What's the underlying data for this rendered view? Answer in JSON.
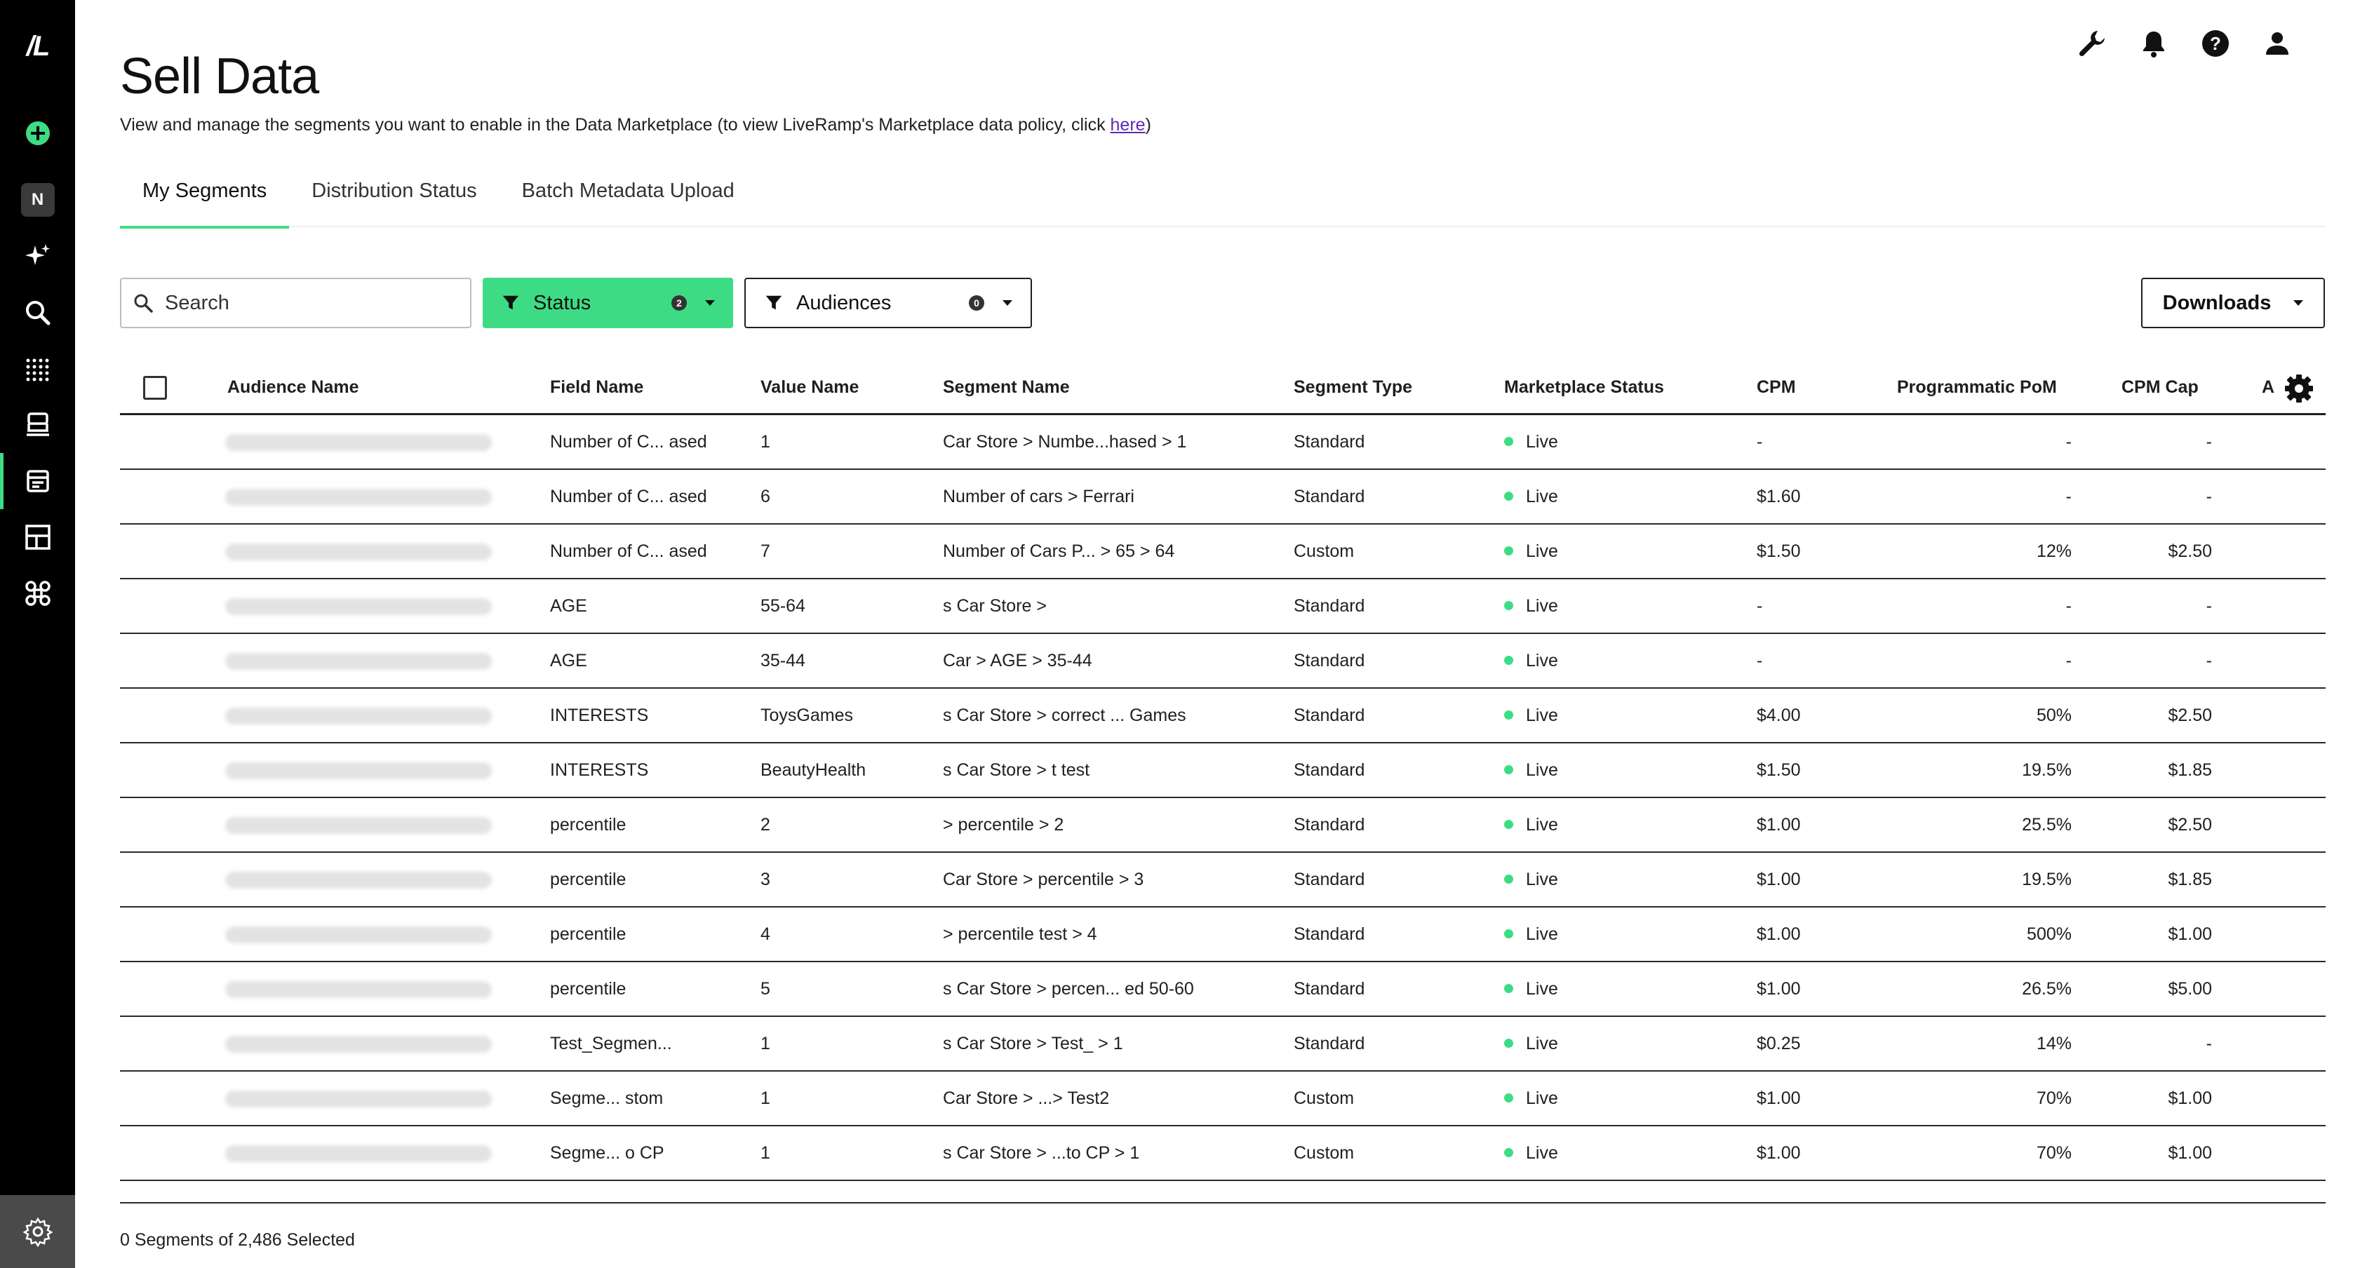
{
  "app": {
    "logo_text": "/L",
    "workspace_initial": "N"
  },
  "header": {
    "title": "Sell Data",
    "description_prefix": "View and manage the segments you want to enable in the Data Marketplace (to view LiveRamp's Marketplace data policy, click ",
    "description_link": "here",
    "description_suffix": ")"
  },
  "tabs": [
    {
      "label": "My Segments",
      "active": true
    },
    {
      "label": "Distribution Status",
      "active": false
    },
    {
      "label": "Batch Metadata Upload",
      "active": false
    }
  ],
  "controls": {
    "search_placeholder": "Search",
    "status_filter": {
      "label": "Status",
      "count": "2"
    },
    "audiences_filter": {
      "label": "Audiences",
      "count": "0"
    },
    "downloads_label": "Downloads"
  },
  "table": {
    "headers": {
      "audience_name": "Audience Name",
      "field_name": "Field Name",
      "value_name": "Value Name",
      "segment_name": "Segment Name",
      "segment_type": "Segment Type",
      "marketplace_status": "Marketplace Status",
      "cpm": "CPM",
      "programmatic_pom": "Programmatic PoM",
      "cpm_cap": "CPM Cap",
      "extra": "A"
    },
    "rows": [
      {
        "field": "Number of C...  ased",
        "value": "1",
        "segment": "Car Store > Numbe...hased > 1",
        "type": "Standard",
        "status": "Live",
        "cpm": "-",
        "pom": "-",
        "cap": "-"
      },
      {
        "field": "Number of C...  ased",
        "value": "6",
        "segment": "Number of cars > Ferrari",
        "type": "Standard",
        "status": "Live",
        "cpm": "$1.60",
        "pom": "-",
        "cap": "-"
      },
      {
        "field": "Number of C...  ased",
        "value": "7",
        "segment": "Number of Cars P...  > 65 > 64",
        "type": "Custom",
        "status": "Live",
        "cpm": "$1.50",
        "pom": "12%",
        "cap": "$2.50"
      },
      {
        "field": "AGE",
        "value": "55-64",
        "segment": "s Car Store > ",
        "type": "Standard",
        "status": "Live",
        "cpm": "-",
        "pom": "-",
        "cap": "-"
      },
      {
        "field": "AGE",
        "value": "35-44",
        "segment": "Car > AGE > 35-44",
        "type": "Standard",
        "status": "Live",
        "cpm": "-",
        "pom": "-",
        "cap": "-"
      },
      {
        "field": "INTERESTS",
        "value": "ToysGames",
        "segment": "s Car Store > correct ...  Games",
        "type": "Standard",
        "status": "Live",
        "cpm": "$4.00",
        "pom": "50%",
        "cap": "$2.50"
      },
      {
        "field": "INTERESTS",
        "value": "BeautyHealth",
        "segment": "s Car Store >  t test",
        "type": "Standard",
        "status": "Live",
        "cpm": "$1.50",
        "pom": "19.5%",
        "cap": "$1.85"
      },
      {
        "field": "percentile",
        "value": "2",
        "segment": "> percentile > 2",
        "type": "Standard",
        "status": "Live",
        "cpm": "$1.00",
        "pom": "25.5%",
        "cap": "$2.50"
      },
      {
        "field": "percentile",
        "value": "3",
        "segment": "Car Store > percentile > 3",
        "type": "Standard",
        "status": "Live",
        "cpm": "$1.00",
        "pom": "19.5%",
        "cap": "$1.85"
      },
      {
        "field": "percentile",
        "value": "4",
        "segment": "> percentile test > 4",
        "type": "Standard",
        "status": "Live",
        "cpm": "$1.00",
        "pom": "500%",
        "cap": "$1.00"
      },
      {
        "field": "percentile",
        "value": "5",
        "segment": "s Car Store > percen...  ed 50-60",
        "type": "Standard",
        "status": "Live",
        "cpm": "$1.00",
        "pom": "26.5%",
        "cap": "$5.00"
      },
      {
        "field": "Test_Segmen...",
        "value": "1",
        "segment": "s Car Store > Test_ > 1",
        "type": "Standard",
        "status": "Live",
        "cpm": "$0.25",
        "pom": "14%",
        "cap": "-"
      },
      {
        "field": "Segme...  stom",
        "value": "1",
        "segment": "Car Store >  ...> Test2",
        "type": "Custom",
        "status": "Live",
        "cpm": "$1.00",
        "pom": "70%",
        "cap": "$1.00"
      },
      {
        "field": "Segme...  o CP",
        "value": "1",
        "segment": "s Car Store >  ...to CP > 1",
        "type": "Custom",
        "status": "Live",
        "cpm": "$1.00",
        "pom": "70%",
        "cap": "$1.00"
      }
    ]
  },
  "footer": {
    "selection_text": "0 Segments of 2,486 Selected"
  },
  "colors": {
    "accent": "#3ddc84",
    "sidebar": "#000000",
    "link": "#5b2bb5"
  }
}
